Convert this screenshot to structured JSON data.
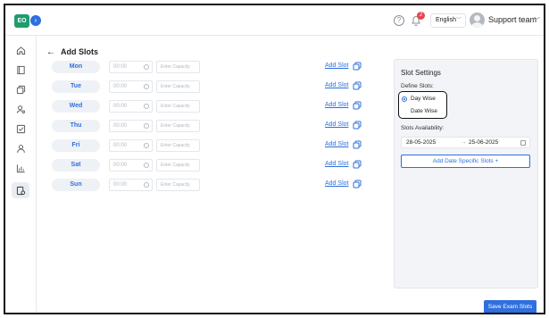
{
  "header": {
    "logo_text": "EO",
    "help_symbol": "?",
    "notification_count": "2",
    "language": "English",
    "user_name": "Support team"
  },
  "sidebar": {
    "items": [
      {
        "icon": "home-icon"
      },
      {
        "icon": "book-icon"
      },
      {
        "icon": "copy-icon"
      },
      {
        "icon": "user-search-icon"
      },
      {
        "icon": "checkbox-icon"
      },
      {
        "icon": "user-icon"
      },
      {
        "icon": "bar-chart-icon"
      },
      {
        "icon": "exam-settings-icon",
        "active": true
      }
    ]
  },
  "page": {
    "title": "Add Slots"
  },
  "slots": {
    "time_placeholder": "00:00",
    "capacity_placeholder": "Enter Capacity",
    "add_slot_label": "Add Slot",
    "days": [
      {
        "label": "Mon"
      },
      {
        "label": "Tue"
      },
      {
        "label": "Wed"
      },
      {
        "label": "Thu"
      },
      {
        "label": "Fri"
      },
      {
        "label": "Sat"
      },
      {
        "label": "Sun"
      }
    ]
  },
  "settings": {
    "title": "Slot Settings",
    "define_label": "Define Slots:",
    "option_day": "Day Wise",
    "option_date": "Date Wise",
    "selected": "Day Wise",
    "availability_label": "Slots Availability:",
    "date_start": "28-05-2025",
    "date_separator": "→",
    "date_end": "25-06-2025",
    "add_date_button": "Add Date Specific Slots  +"
  },
  "footer": {
    "save_button": "Save Exam Slots"
  },
  "colors": {
    "accent": "#2f6fde",
    "brand": "#1e9c6e",
    "badge": "#e5484d"
  }
}
